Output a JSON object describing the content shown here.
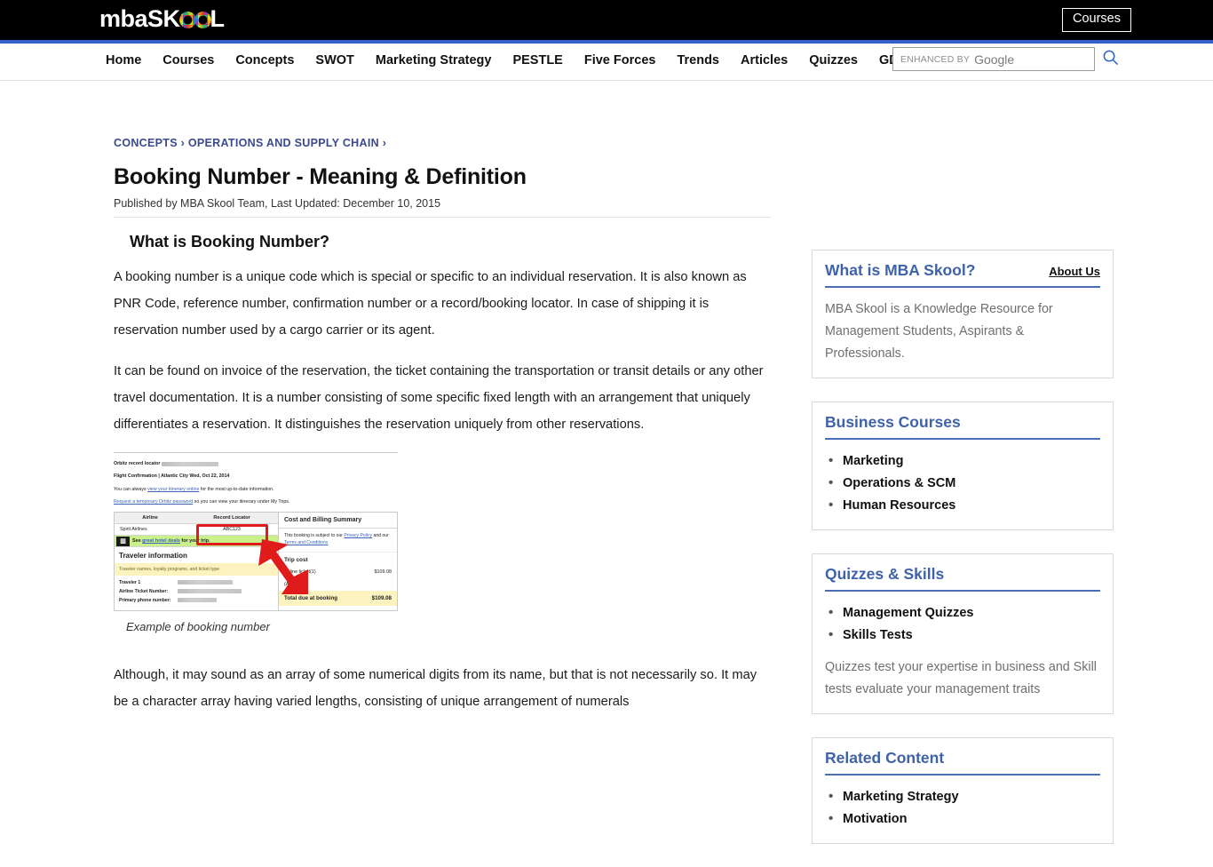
{
  "header": {
    "logo_text_1": "mba",
    "logo_text_2": "SK",
    "logo_text_3": "L",
    "courses_button": "Courses",
    "accent_blue": "#2e62c6",
    "background": "#000000"
  },
  "nav": {
    "items": [
      {
        "label": "Home"
      },
      {
        "label": "Courses"
      },
      {
        "label": "Concepts"
      },
      {
        "label": "SWOT"
      },
      {
        "label": "Marketing Strategy"
      },
      {
        "label": "PESTLE"
      },
      {
        "label": "Five Forces"
      },
      {
        "label": "Trends"
      },
      {
        "label": "Articles"
      },
      {
        "label": "Quizzes"
      },
      {
        "label": "GD Topics"
      }
    ]
  },
  "search": {
    "placeholder_small": "ENHANCED BY",
    "placeholder_brand": "Google",
    "value": "",
    "icon": "search-icon"
  },
  "breadcrumb": {
    "items": [
      "CONCEPTS",
      "OPERATIONS AND SUPPLY CHAIN"
    ],
    "separator": "›",
    "text": "CONCEPTS › OPERATIONS AND SUPPLY CHAIN ›"
  },
  "article": {
    "title": "Booking Number - Meaning & Definition",
    "byline": "Published by MBA Skool Team, Last Updated: December 10, 2015",
    "section_heading": "What is Booking Number?",
    "paragraph_1": "A booking number is a unique code which is special or specific to an individual reservation. It is also known as PNR Code, reference number, confirmation number or a record/booking locator. In case of shipping it is reservation number used by a cargo carrier or its agent.",
    "paragraph_2": "It can be found on invoice of the reservation, the ticket containing the transportation or transit details or any other travel documentation. It is a number consisting of some specific fixed length with an arrangement that uniquely differentiates a reservation. It distinguishes the reservation uniquely from other reservations.",
    "figure_caption": "Example of booking number",
    "paragraph_3": "Although, it may sound as an array of some numerical digits from its name, but that is not necessarily so. It may be a character array having varied lengths, consisting of unique arrangement of numerals"
  },
  "figure": {
    "record_locator_label": "Orbitz record locator",
    "flight_confirmation": "Flight Confirmation | Atlantic City Wed, Oct 22, 2014",
    "itinerary_line_pre": "You can always ",
    "itinerary_link": "view your itinerary online",
    "itinerary_line_post": " for the most up-to-date information.",
    "password_link": "Request a temporary Orbitz password",
    "password_line_post": " so you can view your itinerary under My Trips.",
    "col_head_airline": "Airline",
    "col_head_locator": "Record Locator",
    "airline_name": "Spirit Airlines",
    "booking_number": "ABC123",
    "hotel_deal_pre": "See ",
    "hotel_deal_link": "great hotel deals",
    "hotel_deal_post": " for your trip.",
    "traveler_information": "Traveler information",
    "traveler_note": "Traveler names, loyalty programs, and ticket type",
    "traveler_1_label": "Traveler 1",
    "ticket_number_label": "Airline Ticket Number:",
    "phone_label": "Primary phone number:",
    "cost_title": "Cost and Billing Summary",
    "cost_note_pre": "This booking is subject to our ",
    "cost_note_link1": "Privacy Policy",
    "cost_note_mid": " and our ",
    "cost_note_link2": "Terms and Conditions",
    "cost_subhead": "Trip cost",
    "fare_label": "Airline ticket(1)",
    "fare_value": "$109.08",
    "adult_label": "(Adult: 1)",
    "total_label": "Total due at booking",
    "total_value": "$109.08",
    "highlight_color": "#e01b1b",
    "arrow_color": "#e01b1b"
  },
  "sidebar": {
    "cards": [
      {
        "title": "What is MBA Skool?",
        "action": "About Us",
        "description": "MBA Skool is a Knowledge Resource for Management Students, Aspirants & Professionals.",
        "items": [],
        "note": ""
      },
      {
        "title": "Business Courses",
        "action": "",
        "description": "",
        "items": [
          "Marketing",
          "Operations & SCM",
          "Human Resources"
        ],
        "note": ""
      },
      {
        "title": "Quizzes & Skills",
        "action": "",
        "description": "",
        "items": [
          "Management Quizzes",
          "Skills Tests"
        ],
        "note": "Quizzes test your expertise in business and Skill tests evaluate your management traits"
      },
      {
        "title": "Related Content",
        "action": "",
        "description": "",
        "items": [
          "Marketing Strategy",
          "Motivation"
        ],
        "note": ""
      }
    ]
  }
}
